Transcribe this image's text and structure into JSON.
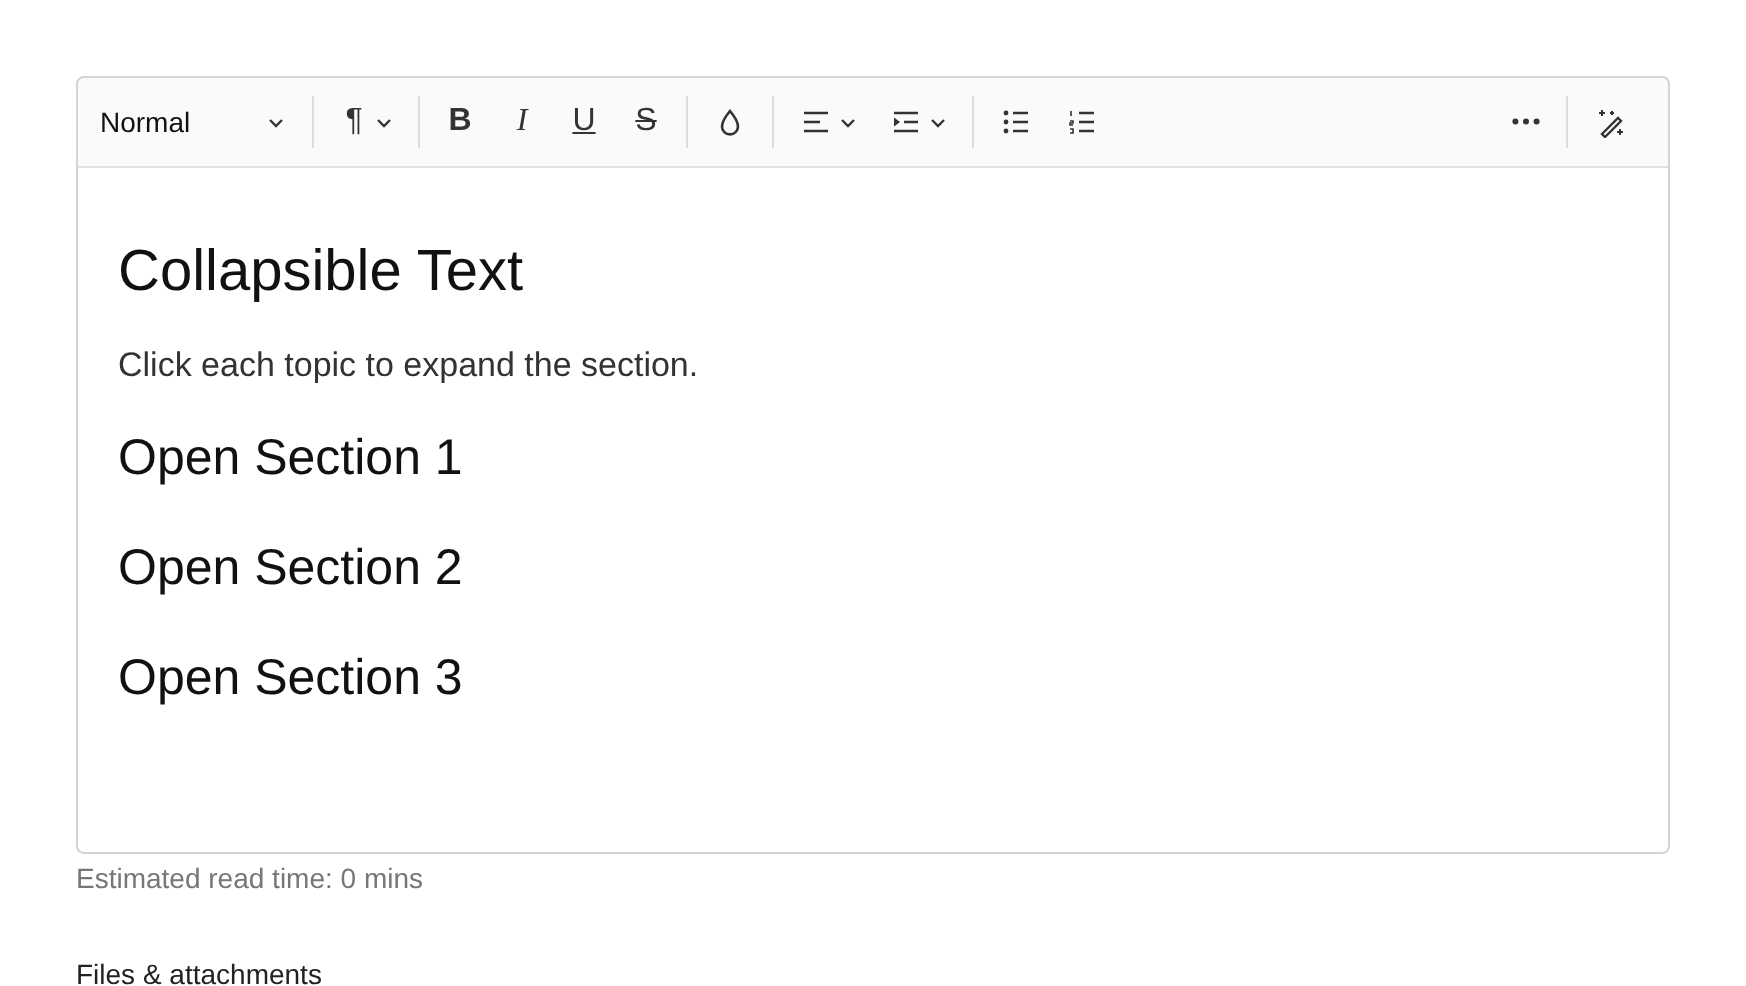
{
  "toolbar": {
    "style_dropdown": {
      "value": "Normal"
    },
    "left_groups": [
      [
        {
          "kind": "paragraph",
          "label": "¶"
        }
      ],
      [
        {
          "kind": "bold",
          "label": "B"
        },
        {
          "kind": "italic",
          "label": "I"
        },
        {
          "kind": "underline",
          "label": "U"
        },
        {
          "kind": "strike",
          "label": "S"
        }
      ],
      [
        {
          "kind": "color"
        }
      ],
      [
        {
          "kind": "align"
        },
        {
          "kind": "indent"
        }
      ],
      [
        {
          "kind": "bullets"
        },
        {
          "kind": "numbered"
        }
      ]
    ],
    "right_groups": [
      [
        {
          "kind": "more"
        }
      ],
      [
        {
          "kind": "magic"
        }
      ]
    ]
  },
  "document": {
    "title": "Collapsible Text",
    "intro": "Click each topic to expand the section.",
    "sections": [
      "Open Section 1",
      "Open Section 2",
      "Open Section 3"
    ]
  },
  "read_time": "Estimated read time: 0 mins",
  "attachments_heading": "Files & attachments"
}
